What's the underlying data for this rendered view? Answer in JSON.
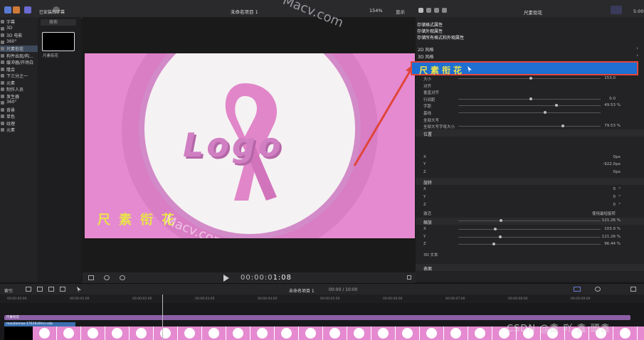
{
  "top_bar": {
    "watermark": "Macv.com",
    "library_title": "已安装的字幕",
    "project_title": "未命名项目 1",
    "zoom": "154%",
    "show_menu": "显示",
    "inspector_title": "尺素衔花",
    "time_right": "5:00"
  },
  "sidebar": {
    "items": [
      {
        "label": "字幕",
        "selected": false
      },
      {
        "label": "3D",
        "selected": false
      },
      {
        "label": "3D 电影",
        "selected": false
      },
      {
        "label": "360°",
        "selected": false
      },
      {
        "label": "尺素衔花",
        "selected": true
      },
      {
        "label": "构件出现/构...",
        "selected": false
      },
      {
        "label": "缓冲器/开场白",
        "selected": false
      },
      {
        "label": "隆会",
        "selected": false
      },
      {
        "label": "下三分之一",
        "selected": false
      },
      {
        "label": "元素",
        "selected": false
      },
      {
        "label": "制作人员",
        "selected": false
      },
      {
        "label": "发生器",
        "selected": false
      },
      {
        "label": "360°",
        "selected": false
      },
      {
        "label": "背景",
        "selected": false
      },
      {
        "label": "单色",
        "selected": false
      },
      {
        "label": "纹理",
        "selected": false
      },
      {
        "label": "元素",
        "selected": false
      }
    ]
  },
  "browser": {
    "search_placeholder": "搜索",
    "thumb_label": "尺素衔花"
  },
  "viewer": {
    "logo_text": "Logo",
    "caption": "尺素衔花",
    "watermark": "Macv.com",
    "timecode_dim": "00:00:0",
    "timecode_bright": "1:08"
  },
  "inspector": {
    "style_menu": [
      "存储格式属性",
      "存储外观属性",
      "存储所有格式和外观属性"
    ],
    "style_2d": "2D 风格",
    "style_3d": "3D 风格",
    "selected_style": "尺素衔花",
    "rows": [
      {
        "label": "大小",
        "value": "153.0",
        "unit": ""
      },
      {
        "label": "对齐",
        "value": "",
        "unit": ""
      },
      {
        "label": "垂直对齐",
        "value": "",
        "unit": ""
      },
      {
        "label": "行间距",
        "value": "0.0",
        "unit": ""
      },
      {
        "label": "字距",
        "value": "49.53",
        "unit": "%"
      },
      {
        "label": "基线",
        "value": "",
        "unit": ""
      },
      {
        "label": "全部大写",
        "value": "",
        "unit": ""
      },
      {
        "label": "全部大写字母大小",
        "value": "79.53",
        "unit": "%"
      }
    ],
    "position_hdr": "位置",
    "position": [
      {
        "label": "X",
        "value": "0",
        "unit": "px"
      },
      {
        "label": "Y",
        "value": "-922.0",
        "unit": "px"
      },
      {
        "label": "Z",
        "value": "0",
        "unit": "px"
      }
    ],
    "rotation_hdr": "旋转",
    "rotation": [
      {
        "label": "X",
        "value": "0",
        "unit": "°"
      },
      {
        "label": "Y",
        "value": "0",
        "unit": "°"
      },
      {
        "label": "Z",
        "value": "0",
        "unit": "°"
      }
    ],
    "animate_label": "激活",
    "animate_value": "使用最短旋转",
    "scale_label": "缩放",
    "scale_value": "121.26",
    "scale": [
      {
        "label": "X",
        "value": "103.9",
        "unit": "%"
      },
      {
        "label": "Y",
        "value": "121.26",
        "unit": "%"
      },
      {
        "label": "Z",
        "value": "96.44",
        "unit": "%"
      }
    ],
    "text_3d": "3D 文本",
    "surface": "表面"
  },
  "timeline": {
    "index_label": "索引",
    "project": "未命名项目 1",
    "duration": "00:00 / 10:00",
    "ticks": [
      "00:00:00:00",
      "00:00:01:00",
      "00:00:02:00",
      "00:00:03:00",
      "00:00:04:00",
      "00:00:05:00",
      "00:00:06:00",
      "00:00:07:00",
      "00:00:08:00",
      "00:00:09:00"
    ],
    "title_clip": "尺素衔花",
    "video_clip": "macblomae-17616(4Hn).sdjs",
    "watermark": "CSDN @鑫 吖 鑫 頭鑫"
  }
}
